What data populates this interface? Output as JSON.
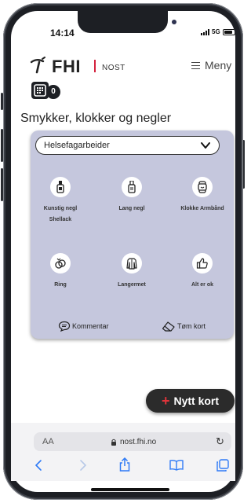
{
  "status": {
    "time": "14:14",
    "network": "5G",
    "battery_level": 0.85
  },
  "header": {
    "logo_text": "FHI",
    "logo_sub": "NOST",
    "menu_label": "Meny"
  },
  "counter": {
    "value": "0"
  },
  "page": {
    "title": "Smykker, klokker og negler"
  },
  "select": {
    "value": "Helsefagarbeider"
  },
  "items": [
    {
      "label": "Kunstig negl\nShellack",
      "icon": "nail-polish-icon"
    },
    {
      "label": "Lang negl",
      "icon": "long-nail-icon"
    },
    {
      "label": "Klokke Armbånd",
      "icon": "watch-icon"
    },
    {
      "label": "Ring",
      "icon": "ring-icon"
    },
    {
      "label": "Langermet",
      "icon": "long-sleeve-icon"
    },
    {
      "label": "Alt er ok",
      "icon": "thumbs-up-icon"
    }
  ],
  "actions": {
    "comment": "Kommentar",
    "clear": "Tøm kort"
  },
  "fab": {
    "label": "Nytt kort"
  },
  "browser": {
    "aa": "AA",
    "url": "nost.fhi.no"
  },
  "colors": {
    "card": "#c5c7dd",
    "accent": "#d4213d",
    "link": "#2f7bf6"
  }
}
